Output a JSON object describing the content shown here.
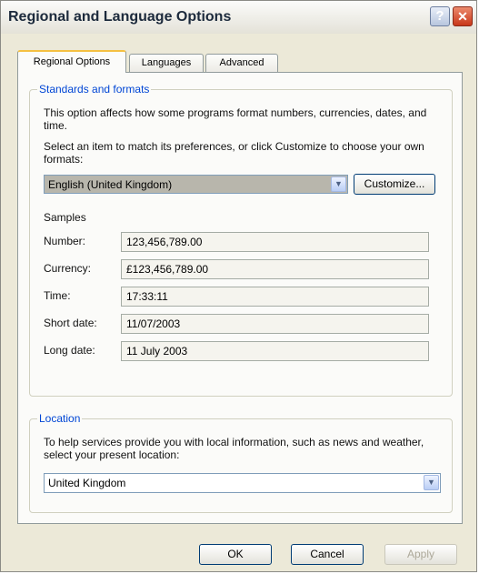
{
  "window": {
    "title": "Regional and Language Options",
    "help_label": "?",
    "close_label": "✕"
  },
  "tabs": [
    {
      "label": "Regional Options",
      "active": true
    },
    {
      "label": "Languages",
      "active": false
    },
    {
      "label": "Advanced",
      "active": false
    }
  ],
  "standards": {
    "legend": "Standards and formats",
    "description": "This option affects how some programs format numbers, currencies, dates, and time.",
    "select_prompt": "Select an item to match its preferences, or click Customize to choose your own formats:",
    "selected_format": "English (United Kingdom)",
    "customize_label": "Customize...",
    "samples_heading": "Samples",
    "samples": [
      {
        "label": "Number:",
        "value": "123,456,789.00"
      },
      {
        "label": "Currency:",
        "value": "£123,456,789.00"
      },
      {
        "label": "Time:",
        "value": "17:33:11"
      },
      {
        "label": "Short date:",
        "value": "11/07/2003"
      },
      {
        "label": "Long date:",
        "value": "11 July 2003"
      }
    ]
  },
  "location": {
    "legend": "Location",
    "description": "To help services provide you with local information, such as news and weather, select your present location:",
    "selected_location": "United Kingdom"
  },
  "footer": {
    "ok_label": "OK",
    "cancel_label": "Cancel",
    "apply_label": "Apply"
  }
}
